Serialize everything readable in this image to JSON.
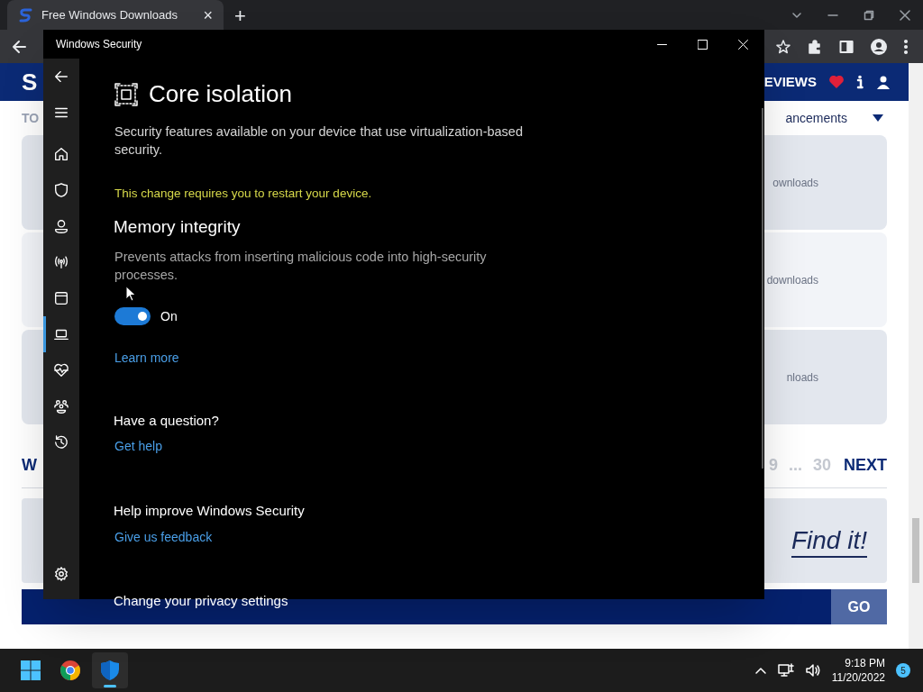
{
  "browser": {
    "tab": {
      "title": "Free Windows Downloads",
      "close": "×"
    },
    "new_tab": "+"
  },
  "website": {
    "logo": "S",
    "nav_right": "EVIEWS",
    "subnav_left": "TO",
    "subnav_right": "ancements",
    "cards": [
      {
        "text": "ownloads"
      },
      {
        "text": "downloads"
      },
      {
        "text": "nloads"
      }
    ],
    "pagination": {
      "left": "W",
      "pages": [
        "9",
        "...",
        "30"
      ],
      "next": "NEXT"
    },
    "banner": "Find it!",
    "search_button": "GO"
  },
  "security_window": {
    "title": "Windows Security",
    "nav": [
      {
        "kind": "back",
        "selected": false
      },
      {
        "kind": "menu",
        "selected": false
      },
      {
        "kind": "home",
        "selected": false
      },
      {
        "kind": "shield",
        "selected": false
      },
      {
        "kind": "person",
        "selected": false
      },
      {
        "kind": "wireless",
        "selected": false
      },
      {
        "kind": "browser",
        "selected": false
      },
      {
        "kind": "laptop",
        "selected": true
      },
      {
        "kind": "health",
        "selected": false
      },
      {
        "kind": "family",
        "selected": false
      },
      {
        "kind": "history",
        "selected": false
      },
      {
        "kind": "settings",
        "selected": false
      }
    ],
    "heading": "Core isolation",
    "intro": "Security features available on your device that use virtualization-based security.",
    "warning": "This change requires you to restart your device.",
    "memory_integrity": {
      "title": "Memory integrity",
      "description": "Prevents attacks from inserting malicious code into high-security processes.",
      "on": true,
      "state_label": "On",
      "link": "Learn more"
    },
    "sections": [
      {
        "title": "Have a question?",
        "link": "Get help"
      },
      {
        "title": "Help improve Windows Security",
        "link": "Give us feedback"
      },
      {
        "title": "Change your privacy settings"
      }
    ]
  },
  "taskbar": {
    "apps": [
      {
        "kind": "start",
        "selected": false
      },
      {
        "kind": "chrome",
        "selected": false
      },
      {
        "kind": "security",
        "selected": true
      }
    ],
    "time": "9:18 PM",
    "date": "11/20/2022",
    "notifications": "5"
  }
}
